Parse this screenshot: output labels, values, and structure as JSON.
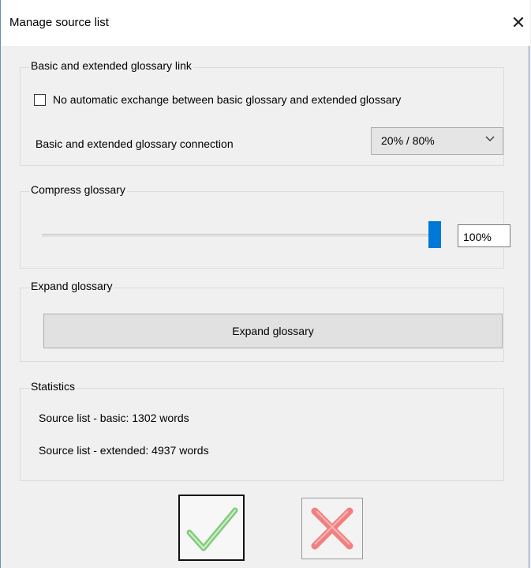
{
  "window": {
    "title": "Manage source list",
    "close_icon": "close-icon"
  },
  "link_group": {
    "legend": "Basic and extended glossary link",
    "checkbox_label": "No automatic exchange between basic glossary and extended glossary",
    "checkbox_checked": false,
    "connection_label": "Basic and extended glossary connection",
    "connection_value": "20% / 80%"
  },
  "compress_group": {
    "legend": "Compress glossary",
    "slider_level_percent": 100,
    "value_text": "100%"
  },
  "expand_group": {
    "legend": "Expand glossary",
    "button_label": "Expand glossary"
  },
  "stats_group": {
    "legend": "Statistics",
    "basic": "Source list - basic: 1302 words",
    "extended": "Source list - extended: 4937 words"
  },
  "footer": {
    "ok_icon": "check-icon",
    "ok_color": "#7fc97a",
    "cancel_icon": "x-icon",
    "cancel_color": "#f08080"
  }
}
